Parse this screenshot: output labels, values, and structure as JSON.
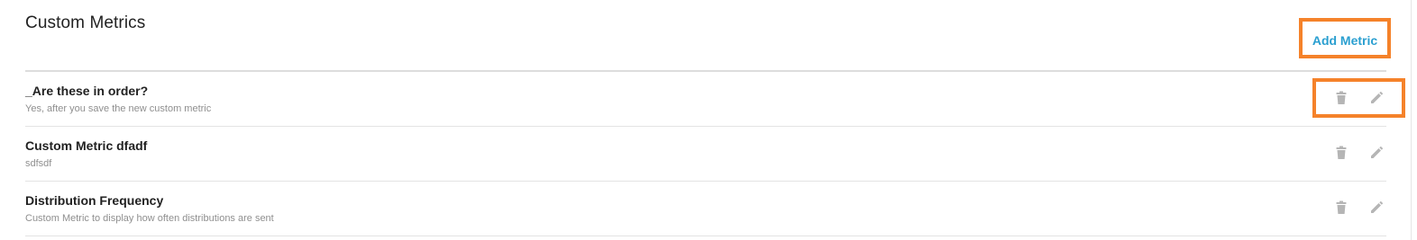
{
  "header": {
    "title": "Custom Metrics",
    "add_button_label": "Add Metric"
  },
  "metrics": [
    {
      "name": "_Are these in order?",
      "description": "Yes, after you save the new custom metric"
    },
    {
      "name": "Custom Metric dfadf",
      "description": "sdfsdf"
    },
    {
      "name": "Distribution Frequency",
      "description": "Custom Metric to display how often distributions are sent"
    }
  ],
  "icons": {
    "delete": "trash-icon",
    "edit": "pencil-icon"
  },
  "colors": {
    "accent": "#2a9fd0",
    "highlight": "#f5822a",
    "icon": "#b5b5b5"
  }
}
